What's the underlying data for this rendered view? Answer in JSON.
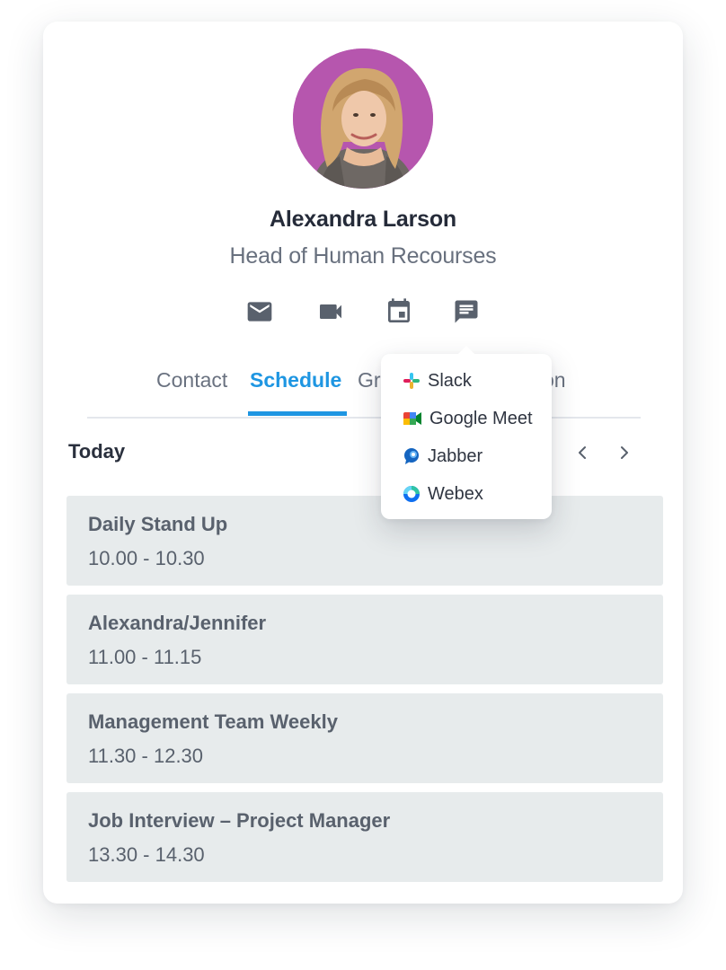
{
  "profile": {
    "name": "Alexandra Larson",
    "role": "Head of Human Recourses"
  },
  "actions": [
    {
      "icon": "mail-icon"
    },
    {
      "icon": "video-icon"
    },
    {
      "icon": "calendar-icon"
    },
    {
      "icon": "chat-icon"
    }
  ],
  "tabs": {
    "items": [
      {
        "label": "Contact",
        "active": false
      },
      {
        "label": "Schedule",
        "active": true
      },
      {
        "label": "Gr",
        "active": false
      },
      {
        "label": "on",
        "active": false
      }
    ],
    "active_color": "#1e96e2"
  },
  "schedule": {
    "heading": "Today",
    "events": [
      {
        "title": "Daily Stand Up",
        "time": "10.00 - 10.30"
      },
      {
        "title": "Alexandra/Jennifer",
        "time": "11.00 - 11.15"
      },
      {
        "title": "Management Team Weekly",
        "time": "11.30 - 12.30"
      },
      {
        "title": "Job Interview – Project Manager",
        "time": "13.30 - 14.30"
      }
    ]
  },
  "chat_menu": {
    "options": [
      {
        "label": "Slack",
        "icon": "slack-icon"
      },
      {
        "label": "Google Meet",
        "icon": "google-meet-icon"
      },
      {
        "label": "Jabber",
        "icon": "jabber-icon"
      },
      {
        "label": "Webex",
        "icon": "webex-icon"
      }
    ]
  }
}
